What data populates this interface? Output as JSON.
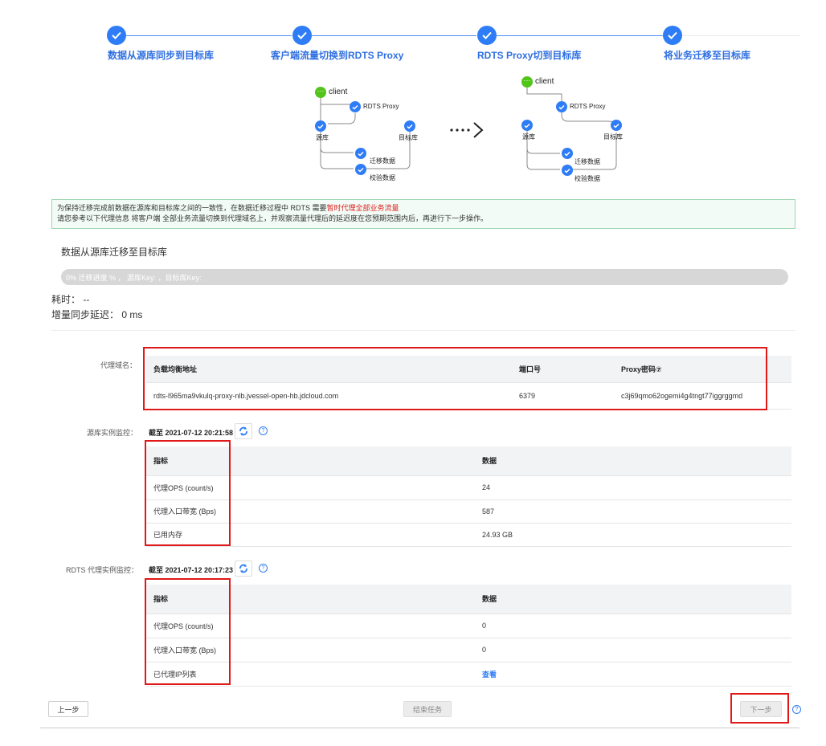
{
  "stepper": {
    "steps": [
      {
        "label": "数据从源库同步到目标库"
      },
      {
        "label": "客户端流量切换到RDTS Proxy"
      },
      {
        "label": "RDTS Proxy切到目标库"
      },
      {
        "label": "将业务迁移至目标库"
      }
    ]
  },
  "diagram": {
    "client": "client",
    "proxy": "RDTS Proxy",
    "source": "源库",
    "target": "目标库",
    "migrate": "迁移数据",
    "verify": "校验数据"
  },
  "notice": {
    "line1_prefix": "为保持迁移完成前数据在源库和目标库之间的一致性，在数据迁移过程中 RDTS 需要",
    "line1_highlight": "暂时代理全部业务流量",
    "line2": "请您参考以下代理信息 将客户端 全部业务流量切换到代理域名上，并观察流量代理后的延迟度在您预期范围内后，再进行下一步操作。"
  },
  "migration": {
    "title": "数据从源库迁移至目标库",
    "progress_text": "0%   迁移进度 % ，  源库Key: ，目标库Key:",
    "progress": 0,
    "elapsed": "耗时：  --",
    "delay": "增量同步延迟：  0 ms"
  },
  "proxy": {
    "label": "代理域名：",
    "headers": [
      "负载均衡地址",
      "端口号",
      "Proxy密码⑦"
    ],
    "row": [
      "rdts-l965ma9vkulq-proxy-nlb.jvessel-open-hb.jdcloud.com",
      "6379",
      "c3j69qmo62ogemi4g4tngt77iggrggmd"
    ]
  },
  "source_monitor": {
    "label": "源库实例监控：",
    "timestamp": "截至 2021-07-12 20:21:58",
    "headers": [
      "指标",
      "数据"
    ],
    "rows": [
      [
        "代理OPS (count/s)",
        "24"
      ],
      [
        "代理入口带宽 (Bps)",
        "587"
      ],
      [
        "已用内存",
        "24.93 GB"
      ]
    ]
  },
  "rdts_monitor": {
    "label": "RDTS 代理实例监控：",
    "timestamp": "截至 2021-07-12 20:17:23",
    "headers": [
      "指标",
      "数据"
    ],
    "rows": [
      [
        "代理OPS (count/s)",
        "0"
      ],
      [
        "代理入口带宽 (Bps)",
        "0"
      ],
      [
        "已代理IP列表",
        "查看"
      ]
    ]
  },
  "footer": {
    "prev": "上一步",
    "end": "结束任务",
    "next": "下一步"
  },
  "colors": {
    "accent": "#2f7df6",
    "highlight": "#e01818",
    "notice_bg": "#f2fbf5"
  }
}
